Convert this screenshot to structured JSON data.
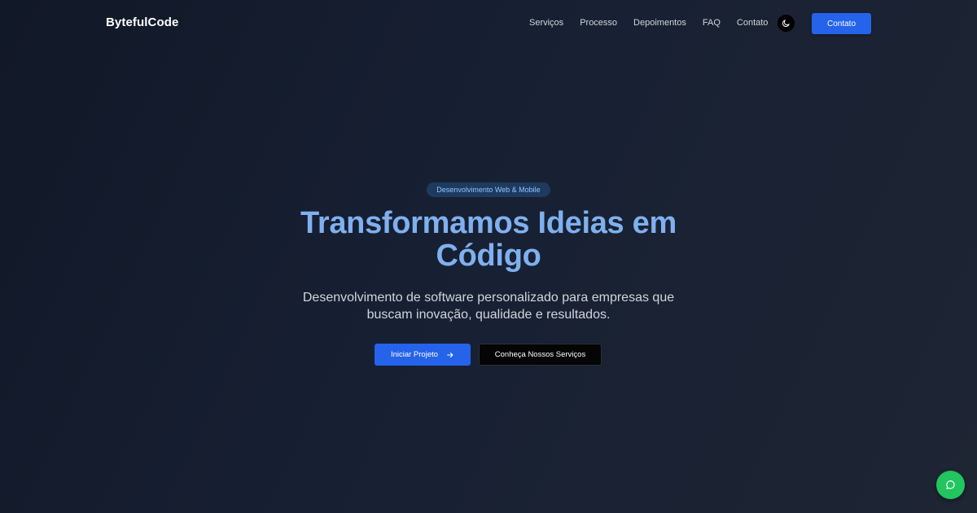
{
  "header": {
    "brand": "BytefulCode",
    "nav": [
      {
        "label": "Serviços"
      },
      {
        "label": "Processo"
      },
      {
        "label": "Depoimentos"
      },
      {
        "label": "FAQ"
      },
      {
        "label": "Contato"
      }
    ],
    "theme_toggle_icon": "moon-icon",
    "cta_label": "Contato"
  },
  "hero": {
    "badge": "Desenvolvimento Web & Mobile",
    "title_line1": "Transformamos Ideias em",
    "title_line2": "Código",
    "subtitle_line1": "Desenvolvimento de software personalizado para empresas que",
    "subtitle_line2": "buscam inovação, qualidade e resultados.",
    "primary_button": "Iniciar Projeto",
    "primary_button_icon": "arrow-right-icon",
    "secondary_button": "Conheça Nossos Serviços"
  },
  "chat_widget": {
    "icon": "chat-bubble-icon"
  },
  "colors": {
    "accent": "#2563eb",
    "title": "#7fb0ef",
    "badge_bg": "#1e3a5f",
    "chat": "#22c55e",
    "background": "#111827"
  }
}
